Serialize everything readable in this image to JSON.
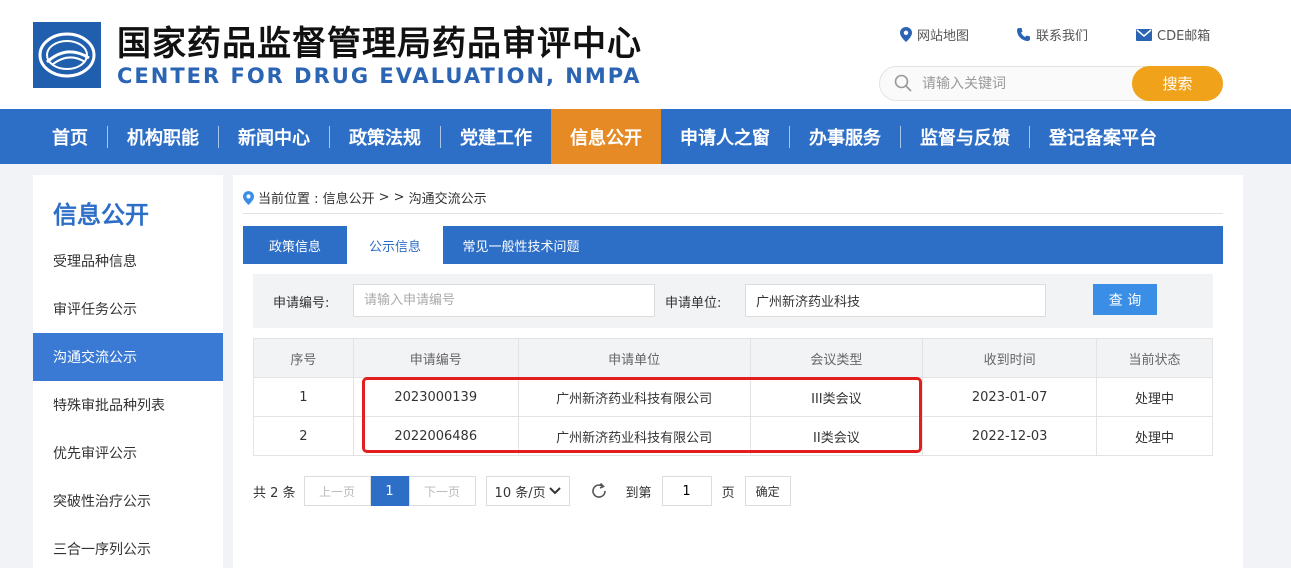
{
  "header": {
    "title": "国家药品监督管理局药品审评中心",
    "subtitle": "CENTER FOR DRUG EVALUATION, NMPA",
    "links": {
      "sitemap": "网站地图",
      "contact": "联系我们",
      "mail": "CDE邮箱"
    },
    "search": {
      "placeholder": "请输入关键词",
      "button": "搜索"
    },
    "accent_color": "#f0a21b"
  },
  "nav": {
    "items": [
      "首页",
      "机构职能",
      "新闻中心",
      "政策法规",
      "党建工作",
      "信息公开",
      "申请人之窗",
      "办事服务",
      "监督与反馈",
      "登记备案平台"
    ],
    "active": "信息公开",
    "bar_color": "#2d6ec7",
    "active_color": "#e58a24"
  },
  "sidebar": {
    "title": "信息公开",
    "items": [
      "受理品种信息",
      "审评任务公示",
      "沟通交流公示",
      "特殊审批品种列表",
      "优先审评公示",
      "突破性治疗公示",
      "三合一序列公示"
    ],
    "active": "沟通交流公示"
  },
  "breadcrumb": {
    "prefix": "当前位置 : 信息公开",
    "sep": "> >",
    "current": "沟通交流公示"
  },
  "tabs": {
    "items": [
      "政策信息",
      "公示信息",
      "常见一般性技术问题"
    ],
    "active": "公示信息"
  },
  "query": {
    "app_no_label": "申请编号:",
    "app_no_placeholder": "请输入申请编号",
    "applicant_label": "申请单位:",
    "applicant_value": "广州新济药业科技",
    "button": "查 询"
  },
  "table": {
    "headers": [
      "序号",
      "申请编号",
      "申请单位",
      "会议类型",
      "收到时间",
      "当前状态"
    ],
    "rows": [
      [
        "1",
        "2023000139",
        "广州新济药业科技有限公司",
        "III类会议",
        "2023-01-07",
        "处理中"
      ],
      [
        "2",
        "2022006486",
        "广州新济药业科技有限公司",
        "II类会议",
        "2022-12-03",
        "处理中"
      ]
    ]
  },
  "pagination": {
    "total": "共 2 条",
    "prev": "上一页",
    "current": "1",
    "next": "下一页",
    "page_size": "10 条/页",
    "goto_label": "到第",
    "goto_value": "1",
    "page_unit": "页",
    "confirm": "确定"
  }
}
